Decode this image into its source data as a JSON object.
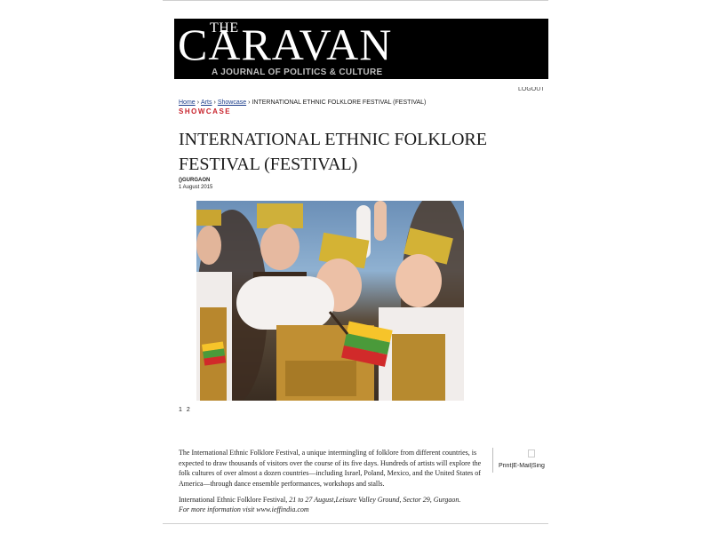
{
  "masthead": {
    "the": "THE",
    "title": "CARAVAN",
    "tagline": "A JOURNAL OF POLITICS & CULTURE"
  },
  "top_right_fragment": "LOGOUT",
  "breadcrumb": {
    "home": "Home",
    "arts": "Arts",
    "showcase": "Showcase",
    "current": "INTERNATIONAL ETHNIC FOLKLORE FESTIVAL (FESTIVAL)",
    "separator": "›"
  },
  "section": "SHOWCASE",
  "article": {
    "title": "INTERNATIONAL ETHNIC FOLKLORE FESTIVAL (FESTIVAL)",
    "location": "()GURGAON",
    "date": "1 August 2015",
    "pages": [
      "1",
      "2"
    ],
    "body": "The International Ethnic Folklore Festival, a unique intermingling of folklore from different countries, is expected to draw thousands of visitors over the course of its five days. Hundreds of artists will explore the folk cultures of over almost a dozen countries—including Israel, Poland, Mexico, and the United States of America—through dance ensemble performances, workshops and stalls.",
    "details_prefix": "International Ethnic Folklore Festival, ",
    "details_italic": "21 to 27 August,Leisure Valley Ground, Sector 29, Gurgaon.",
    "more_info": "For more information visit www.ieffindia.com"
  },
  "share": {
    "print": "Print",
    "sep": "|",
    "email": "E-Mail",
    "sign": "Sing"
  },
  "colors": {
    "section": "#c8232c",
    "link": "#1a3c8a",
    "masthead_bg": "#000000"
  }
}
